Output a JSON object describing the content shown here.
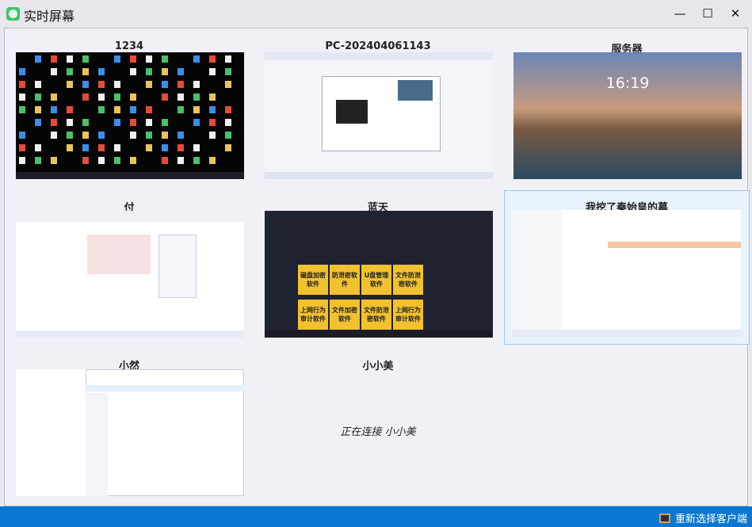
{
  "window": {
    "title": "实时屏幕",
    "minimize": "—",
    "maximize": "☐",
    "close": "✕"
  },
  "clients": [
    {
      "name": "1234"
    },
    {
      "name": "PC-202404061143"
    },
    {
      "name": "服务器",
      "clock": "16:19"
    },
    {
      "name": "付"
    },
    {
      "name": "蓝天",
      "cards": [
        "磁盘加密软件",
        "防泄密软件",
        "U盘管理软件",
        "文件防泄密软件",
        "上网行为审计软件",
        "文件加密软件",
        "文件防泄密软件",
        "上网行为审计软件"
      ]
    },
    {
      "name": "我挖了秦始皇的墓"
    },
    {
      "name": "小然"
    },
    {
      "name": "小小美",
      "status": "正在连接 小小美"
    }
  ],
  "footer": {
    "reselect_label": "重新选择客户端"
  }
}
